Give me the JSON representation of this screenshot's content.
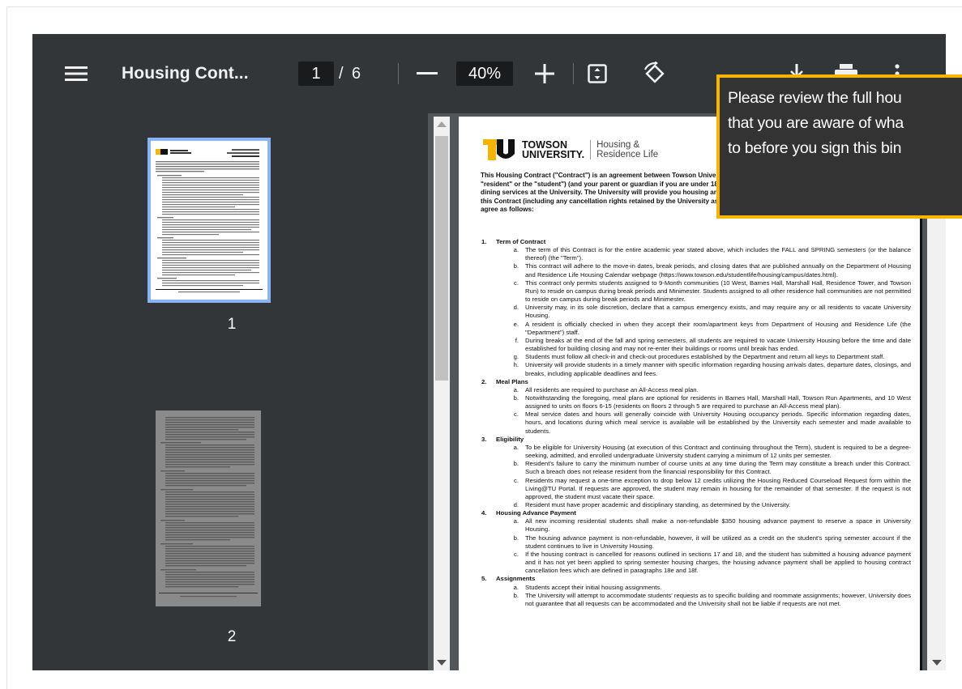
{
  "toolbar": {
    "title": "Housing Cont...",
    "page_current": "1",
    "page_sep": "/",
    "page_total": "6",
    "zoom": "40%",
    "icons": [
      "menu-icon",
      "zoom-out-icon",
      "zoom-in-icon",
      "fit-page-icon",
      "rotate-icon",
      "download-icon",
      "print-icon",
      "more-options-icon"
    ]
  },
  "sidebar": {
    "thumbnails": [
      {
        "label": "1",
        "selected": true
      },
      {
        "label": "2",
        "selected": false
      }
    ]
  },
  "tooltip": {
    "lines": [
      "Please review the full hou",
      "that you are aware of wha",
      "to before you sign this bin"
    ],
    "border_color": "#f7b500"
  },
  "document": {
    "logo_name_1": "TOWSON",
    "logo_name_2": "UNIVERSITY.",
    "logo_unit_1": "Housing &",
    "logo_unit_2": "Residence Life",
    "intro": [
      "This Housing Contract (\"Contract\") is an agreement between Towson Unive",
      "\"resident\" or the \"student\") (and your parent or guardian if you are under 18",
      "dining services at the University. The University will provide you housing an",
      "this Contract (including any cancellation rights retained by the University as",
      "agree as follows:"
    ],
    "sections": [
      {
        "num": "1.",
        "title": "Term of Contract",
        "items": [
          {
            "l": "a.",
            "t": "The term of this Contract is for the entire academic year stated above, which includes the FALL and SPRING semesters (or the balance thereof) (the \"Term\")."
          },
          {
            "l": "b.",
            "t": "This contract will adhere to the move-in dates, break periods, and closing dates that are published annually on the Department of Housing and Residence Life Housing Calendar webpage (https://www.towson.edu/studentlife/housing/campus/dates.html)."
          },
          {
            "l": "c.",
            "t": "This contract only permits students assigned to 9-Month communities (10 West, Barnes Hall, Marshall Hall, Residence Tower, and Towson Run) to reside on campus during break periods and Minimester. Students assigned to all other residence hall communities are not permitted to reside on campus during break periods and Minimester."
          },
          {
            "l": "d.",
            "t": "University may, in its sole discretion, declare that a campus emergency exists, and may require any or all residents to vacate University Housing."
          },
          {
            "l": "e.",
            "t": "A resident is officially checked in when they accept their room/apartment keys from Department of Housing and Residence Life (the \"Department\") staff."
          },
          {
            "l": "f.",
            "t": "During breaks at the end of the fall and spring semesters, all students are required to vacate University Housing before the time and date established for building closing and may not re-enter their buildings or rooms until break has ended."
          },
          {
            "l": "g.",
            "t": "Students must follow all check-in and check-out procedures established by the Department and return all keys to Department staff."
          },
          {
            "l": "h.",
            "t": "University will provide students in a timely manner with specific information regarding housing arrivals dates, departure dates, closings, and breaks, including applicable deadlines and fees."
          }
        ]
      },
      {
        "num": "2.",
        "title": "Meal Plans",
        "items": [
          {
            "l": "a.",
            "t": "All residents are required to purchase an All-Access meal plan."
          },
          {
            "l": "b.",
            "t": "Notwithstanding the foregoing, meal plans are optional for residents in Barnes Hall, Marshall Hall, Towson Run Apartments, and 10 West assigned to units on floors 6-15 (residents on floors 2 through 5 are required to purchase an All-Access meal plan)."
          },
          {
            "l": "c.",
            "t": "Meal service dates and hours will generally coincide with University Housing occupancy periods. Specific information regarding dates, hours, and locations during which meal service is available will be established by the University each semester and made available to students."
          }
        ]
      },
      {
        "num": "3.",
        "title": "Eligibility",
        "items": [
          {
            "l": "a.",
            "t": "To be eligible for University Housing (at execution of this Contract and continuing throughout the Term), student is required to be a degree-seeking, admitted, and enrolled undergraduate University student carrying a minimum of 12 units per semester."
          },
          {
            "l": "b.",
            "t": "Resident's failure to carry the minimum number of course units at any time during the Term may constitute a breach under this Contract. Such a breach does not release resident from the financial responsibility for this Contract."
          },
          {
            "l": "c.",
            "t": "Residents may request a one-time exception to drop below 12 credits utilizing the Housing Reduced Courseload Request form within the Living@TU Portal. If requests are approved, the student may remain in housing for the remainder of that semester. If the request is not approved, the student must vacate their space."
          },
          {
            "l": "d.",
            "t": "Resident must have proper academic and disciplinary standing, as determined by the University."
          }
        ]
      },
      {
        "num": "4.",
        "title": "Housing Advance Payment",
        "items": [
          {
            "l": "a.",
            "t": "All new incoming residential students shall make a non-refundable $350 housing advance payment to reserve a space in University Housing."
          },
          {
            "l": "b.",
            "t": "The housing advance payment is non-refundable, however, it will be utilized as a credit on the student's spring semester account if the student continues to live in University Housing."
          },
          {
            "l": "c.",
            "t": "If the housing contract is cancelled for reasons outlined in sections 17 and 18, and the student has submitted a housing advance payment and it has not yet been applied to spring semester housing charges, the housing advance payment shall be applied to housing contract cancellation fees which are defined in paragraphs 18e and 18f."
          }
        ]
      },
      {
        "num": "5.",
        "title": "Assignments",
        "items": [
          {
            "l": "a.",
            "t": "Students accept their initial housing assignments."
          },
          {
            "l": "b.",
            "t": "The University will attempt to accommodate students' requests as to specific building and roommate assignments; however, University does not guarantee that all requests can be accommodated and the University shall not be liable if requests are not met."
          }
        ]
      }
    ]
  }
}
